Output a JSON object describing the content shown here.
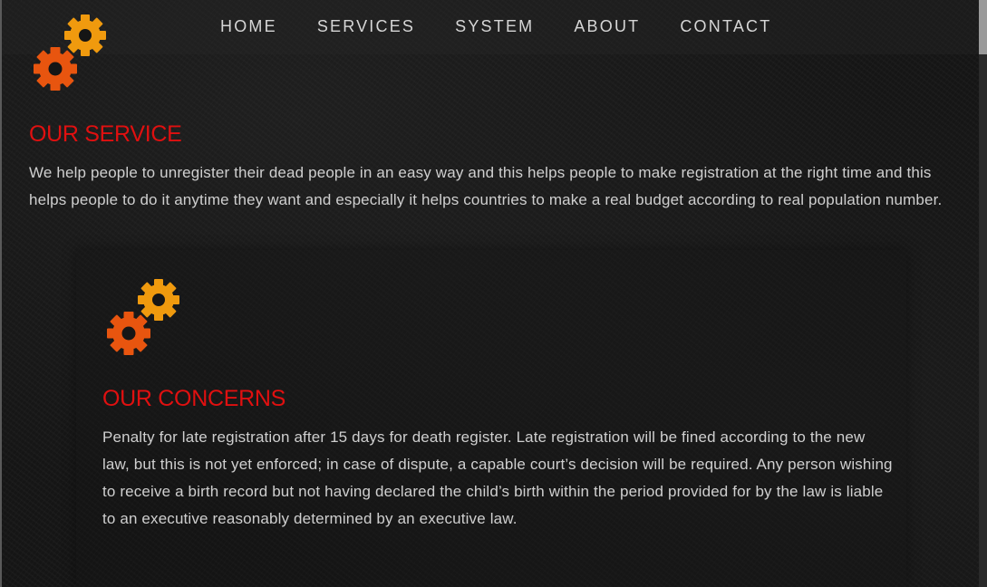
{
  "nav": {
    "items": [
      {
        "label": "HOME"
      },
      {
        "label": "SERVICES"
      },
      {
        "label": "SYSTEM"
      },
      {
        "label": "ABOUT"
      },
      {
        "label": "CONTACT"
      }
    ]
  },
  "service": {
    "title": "OUR SERVICE",
    "text": "We help people to unregister their dead people in an easy way and this helps people to make registration at the right time and this helps people to do it anytime they want and especially it helps countries to make a real budget according to real population number."
  },
  "concerns": {
    "title": "OUR CONCERNS",
    "text": "Penalty for late registration after 15 days for death register. Late registration will be fined according to the new law, but this is not yet enforced; in case of dispute, a capable court’s decision will be required. Any person wishing to receive a birth record but not having declared the child’s birth within the period provided for by the law is liable to an executive reasonably determined by an executive law."
  },
  "colors": {
    "heading": "#e01010",
    "gear_large": "#e8550f",
    "gear_small": "#f09a0e",
    "background": "#151515",
    "text": "#cfcfcf"
  },
  "icons": {
    "logo": "gears-icon"
  }
}
